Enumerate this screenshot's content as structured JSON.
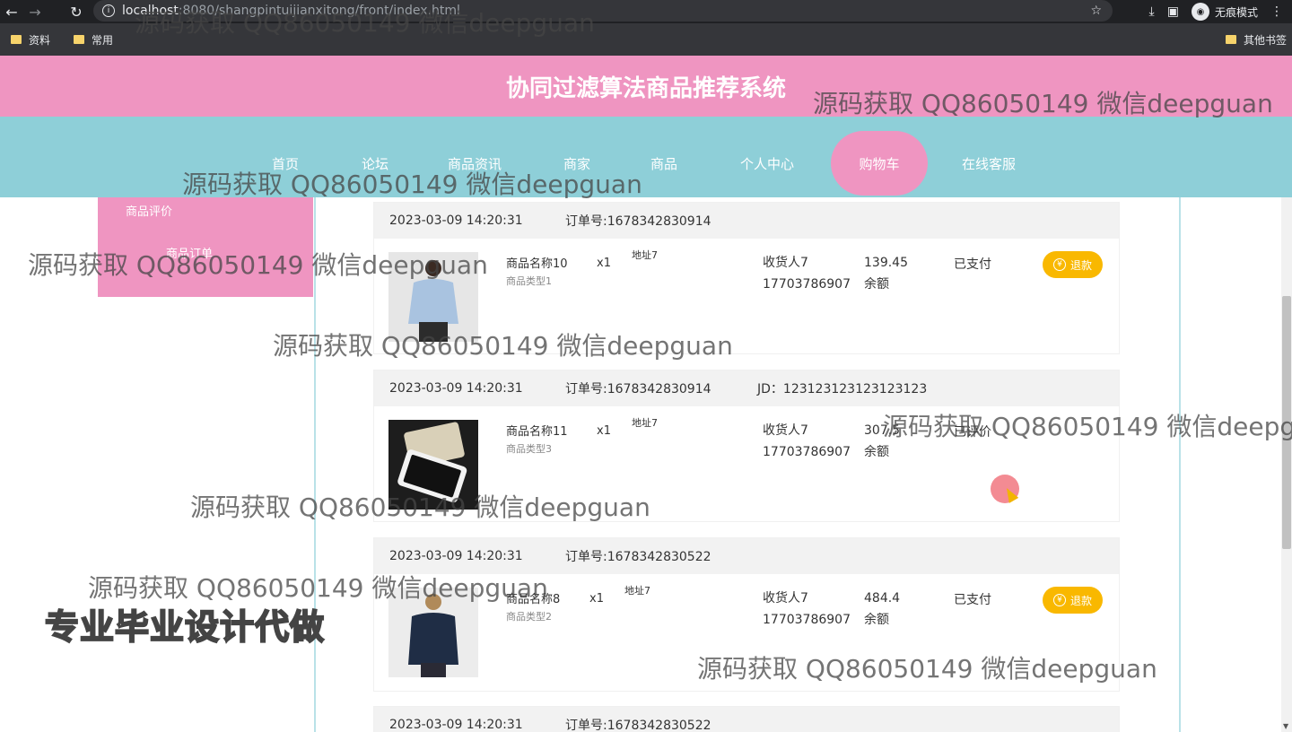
{
  "browser": {
    "url_host": "localhost",
    "url_path": ":8080/shangpintuijianxitong/front/index.html",
    "incognito_label": "无痕模式",
    "bookmarks": [
      "资料",
      "常用"
    ],
    "other_bookmarks": "其他书签"
  },
  "site": {
    "title": "协同过滤算法商品推荐系统"
  },
  "nav": {
    "items": [
      "首页",
      "论坛",
      "商品资讯",
      "商家",
      "商品",
      "个人中心",
      "购物车",
      "在线客服"
    ],
    "active": "购物车"
  },
  "side_menu": {
    "items": [
      "商品评价",
      "商品订单"
    ]
  },
  "orders": [
    {
      "time": "2023-03-09 14:20:31",
      "order_no": "订单号:1678342830914",
      "extra": "",
      "product_name": "商品名称10",
      "product_type": "商品类型1",
      "qty": "x1",
      "address": "地址7",
      "receiver": "收货人7",
      "phone": "17703786907",
      "price": "139.45",
      "pay_method": "余额",
      "status": "已支付",
      "action": "退款",
      "image": "shirt-model"
    },
    {
      "time": "2023-03-09 14:20:31",
      "order_no": "订单号:1678342830914",
      "extra": "JD：123123123123123123",
      "product_name": "商品名称11",
      "product_type": "商品类型3",
      "qty": "x1",
      "address": "地址7",
      "receiver": "收货人7",
      "phone": "17703786907",
      "price": "307.5",
      "pay_method": "余额",
      "status": "已评价",
      "action": "",
      "image": "phones"
    },
    {
      "time": "2023-03-09 14:20:31",
      "order_no": "订单号:1678342830522",
      "extra": "",
      "product_name": "商品名称8",
      "product_type": "商品类型2",
      "qty": "x1",
      "address": "地址7",
      "receiver": "收货人7",
      "phone": "17703786907",
      "price": "484.4",
      "pay_method": "余额",
      "status": "已支付",
      "action": "退款",
      "image": "jacket-model"
    },
    {
      "time": "2023-03-09 14:20:31",
      "order_no": "订单号:1678342830522"
    }
  ],
  "watermark": {
    "text": "源码获取 QQ86050149 微信deepguan",
    "big": "专业毕业设计代做"
  },
  "colors": {
    "header_pink": "#ef95c1",
    "nav_teal": "#8ecfd8",
    "refund_yellow": "#f9b800"
  }
}
